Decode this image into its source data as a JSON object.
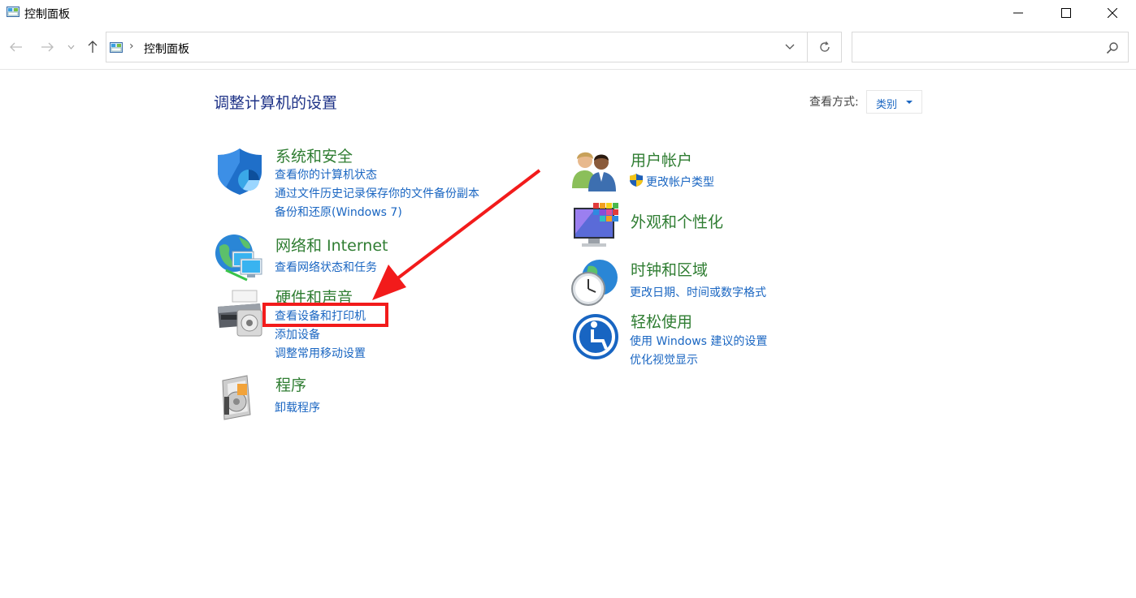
{
  "window": {
    "title": "控制面板",
    "minimize_label": "—",
    "maximize_label": "☐",
    "close_label": "✕"
  },
  "nav": {
    "back_icon": "arrow-left-icon",
    "forward_icon": "arrow-right-icon",
    "recent_icon": "chevron-down-icon",
    "up_icon": "arrow-up-icon",
    "breadcrumb": [
      "控制面板"
    ],
    "search_placeholder": ""
  },
  "main": {
    "title": "调整计算机的设置",
    "view_by_label": "查看方式:",
    "view_by_value": "类别"
  },
  "categories": [
    {
      "icon": "shield-icon",
      "heading": "系统和安全",
      "links": [
        "查看你的计算机状态",
        "通过文件历史记录保存你的文件备份副本",
        "备份和还原(Windows 7)"
      ]
    },
    {
      "icon": "network-globe-icon",
      "heading": "网络和 Internet",
      "links": [
        "查看网络状态和任务"
      ]
    },
    {
      "icon": "printer-icon",
      "heading": "硬件和声音",
      "links": [
        "查看设备和打印机",
        "添加设备",
        "调整常用移动设置"
      ]
    },
    {
      "icon": "programs-disc-icon",
      "heading": "程序",
      "links": [
        "卸载程序"
      ]
    },
    {
      "icon": "users-icon",
      "heading": "用户帐户",
      "links": [
        "更改帐户类型"
      ]
    },
    {
      "icon": "display-palette-icon",
      "heading": "外观和个性化",
      "links": []
    },
    {
      "icon": "clock-globe-icon",
      "heading": "时钟和区域",
      "links": [
        "更改日期、时间或数字格式"
      ]
    },
    {
      "icon": "ease-of-access-icon",
      "heading": "轻松使用",
      "links": [
        "使用 Windows 建议的设置",
        "优化视觉显示"
      ]
    }
  ],
  "colors": {
    "title": "#1e3287",
    "heading": "#2f7d32",
    "link": "#1a66c2",
    "annotation": "#f21b1b"
  }
}
